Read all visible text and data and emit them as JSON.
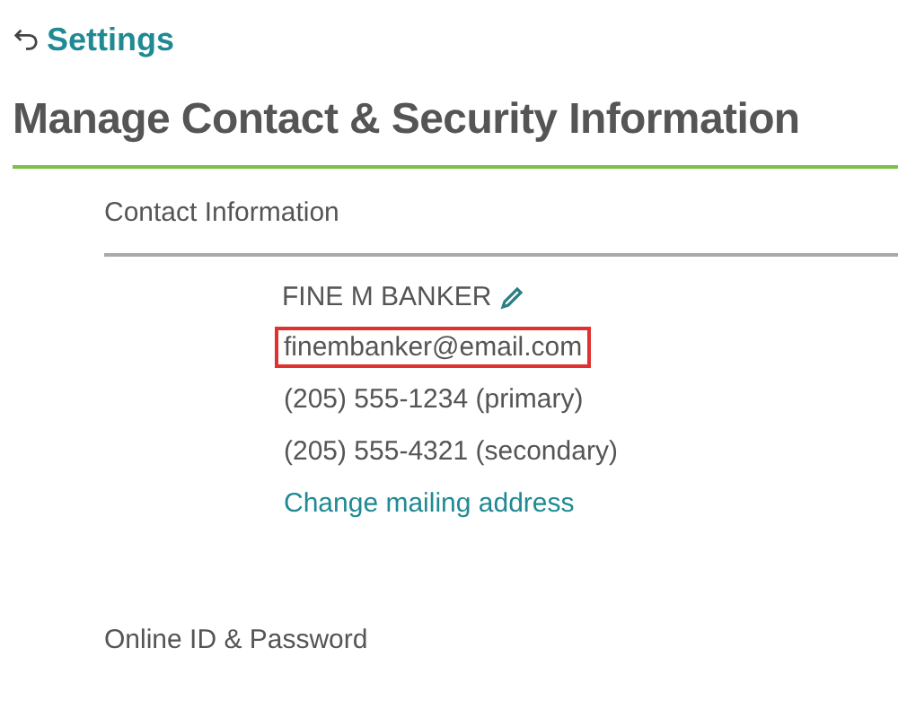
{
  "back_link": {
    "label": "Settings"
  },
  "title": "Manage Contact & Security Information",
  "sections": [
    {
      "heading": "Contact Information",
      "name": "FINE M BANKER",
      "lines": [
        {
          "text": "finembanker@email.com",
          "kind": "text",
          "highlighted": true
        },
        {
          "text": "(205) 555-1234 (primary)",
          "kind": "text",
          "highlighted": false
        },
        {
          "text": "(205) 555-4321 (secondary)",
          "kind": "text",
          "highlighted": false
        },
        {
          "text": "Change mailing address",
          "kind": "link",
          "highlighted": false
        }
      ]
    },
    {
      "heading": "Online ID & Password"
    }
  ]
}
